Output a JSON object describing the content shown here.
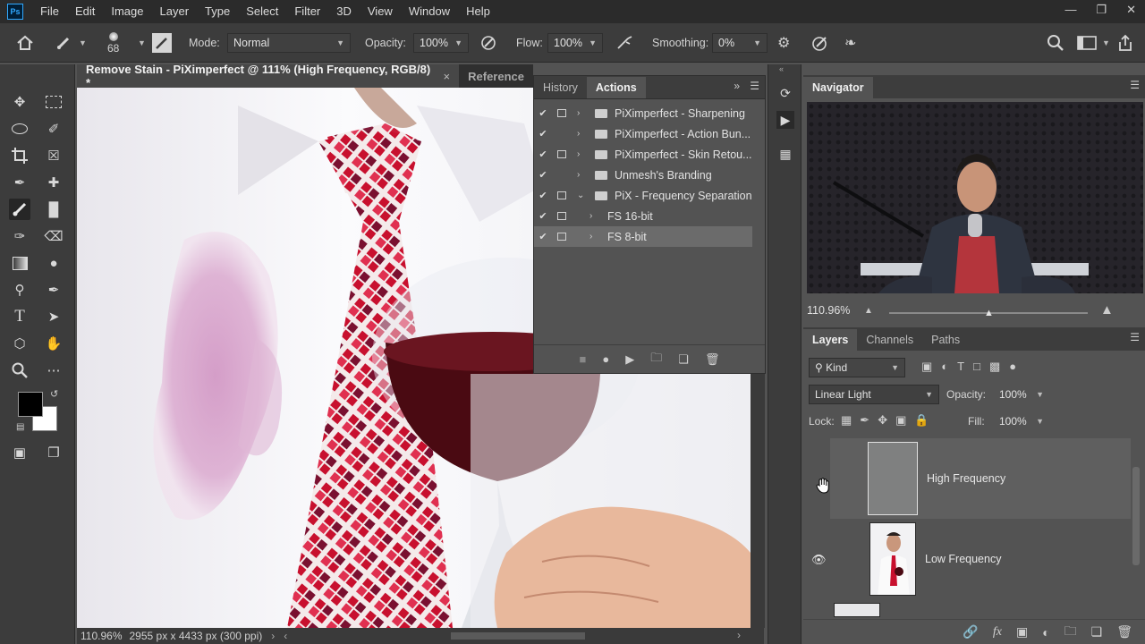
{
  "menubar": {
    "logo": "Ps",
    "items": [
      "File",
      "Edit",
      "Image",
      "Layer",
      "Type",
      "Select",
      "Filter",
      "3D",
      "View",
      "Window",
      "Help"
    ]
  },
  "options": {
    "brush_size": "68",
    "mode_label": "Mode:",
    "mode_value": "Normal",
    "opacity_label": "Opacity:",
    "opacity_value": "100%",
    "flow_label": "Flow:",
    "flow_value": "100%",
    "smoothing_label": "Smoothing:",
    "smoothing_value": "0%"
  },
  "document": {
    "active_tab": "Remove Stain - PiXimperfect @ 111% (High Frequency, RGB/8) *",
    "inactive_tab": "Reference",
    "status_zoom": "110.96%",
    "status_info": "2955 px x 4433 px (300 ppi)"
  },
  "actions_panel": {
    "tabs": [
      "History",
      "Actions"
    ],
    "active_tab": "Actions",
    "rows": [
      {
        "label": "PiXimperfect - Sharpening",
        "checked": true,
        "dialog": true,
        "indent": 0,
        "folder": true,
        "expanded": false
      },
      {
        "label": "PiXimperfect - Action Bun...",
        "checked": true,
        "dialog": false,
        "indent": 0,
        "folder": true,
        "expanded": false
      },
      {
        "label": "PiXimperfect - Skin Retou...",
        "checked": true,
        "dialog": true,
        "indent": 0,
        "folder": true,
        "expanded": false
      },
      {
        "label": "Unmesh's Branding",
        "checked": true,
        "dialog": false,
        "indent": 0,
        "folder": true,
        "expanded": false
      },
      {
        "label": "PiX - Frequency Separation",
        "checked": true,
        "dialog": true,
        "indent": 0,
        "folder": true,
        "expanded": true
      },
      {
        "label": "FS 16-bit",
        "checked": true,
        "dialog": true,
        "indent": 1,
        "folder": false,
        "expanded": false
      },
      {
        "label": "FS 8-bit",
        "checked": true,
        "dialog": true,
        "indent": 1,
        "folder": false,
        "expanded": false,
        "selected": true
      }
    ]
  },
  "navigator": {
    "title": "Navigator",
    "zoom": "110.96%"
  },
  "layers_panel": {
    "tabs": [
      "Layers",
      "Channels",
      "Paths"
    ],
    "active_tab": "Layers",
    "filter_value": "Kind",
    "blend_mode": "Linear Light",
    "opacity_label": "Opacity:",
    "opacity_value": "100%",
    "lock_label": "Lock:",
    "fill_label": "Fill:",
    "fill_value": "100%",
    "layers": [
      {
        "name": "High Frequency",
        "visible": false,
        "selected": true
      },
      {
        "name": "Low Frequency",
        "visible": true,
        "selected": false
      }
    ]
  },
  "colors": {
    "accent": "#31a8ff",
    "foreground": "#000000",
    "background": "#ffffff",
    "stain": "#c98ab8",
    "wine": "#4a0a12",
    "tie_red": "#c8102e"
  }
}
